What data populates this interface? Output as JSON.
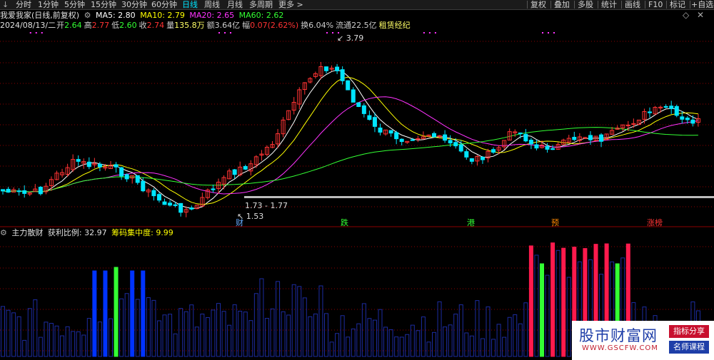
{
  "topbar": {
    "back_glyph": "↓",
    "tabs": [
      {
        "label": "分时",
        "active": false
      },
      {
        "label": "1分钟",
        "active": false
      },
      {
        "label": "5分钟",
        "active": false
      },
      {
        "label": "15分钟",
        "active": false
      },
      {
        "label": "30分钟",
        "active": false
      },
      {
        "label": "60分钟",
        "active": false
      },
      {
        "label": "日线",
        "active": true
      },
      {
        "label": "周线",
        "active": false
      },
      {
        "label": "月线",
        "active": false
      },
      {
        "label": "多周期",
        "active": false
      },
      {
        "label": "更多 >",
        "active": false
      }
    ],
    "right_buttons": [
      "复权",
      "叠加",
      "多股",
      "统计",
      "画线",
      "F10",
      "标记",
      "+自选"
    ]
  },
  "header": {
    "stock_name": "我爱我家(日线,前复权)",
    "ma": [
      {
        "label": "MA5: 2.80",
        "color": "#ffffff"
      },
      {
        "label": "MA10: 2.79",
        "color": "#ffff00"
      },
      {
        "label": "MA20: 2.65",
        "color": "#ff33ff"
      },
      {
        "label": "MA60: 2.62",
        "color": "#33ff33"
      }
    ],
    "window_icons": [
      "◇",
      "✕"
    ]
  },
  "quote": {
    "date": "2024/08/13/二",
    "open_label": "开",
    "open": "2.64",
    "high_label": "高",
    "high": "2.77",
    "low_label": "低",
    "low": "2.60",
    "close_label": "收",
    "close": "2.74",
    "vol_label": "量",
    "vol": "135.8万",
    "amount_label": "额",
    "amount": "3.64亿",
    "change_label": "幅",
    "change": "0.07(2.62%)",
    "turnover_label": "换",
    "turnover": "6.04%",
    "float_label": "流通",
    "float": "22.5亿",
    "concept": "租赁经纪"
  },
  "annotations": {
    "high_label": "3.79",
    "low_label": "1.53",
    "range_label": "1.73 - 1.77",
    "events": [
      {
        "label": "财",
        "color": "#66aaff"
      },
      {
        "label": "跌",
        "color": "#33ff33"
      },
      {
        "label": "港",
        "color": "#33ff33"
      },
      {
        "label": "预",
        "color": "#ff8800"
      },
      {
        "label": "涨榜",
        "color": "#ff3333"
      }
    ]
  },
  "indicator": {
    "name": "主力散财",
    "ratio_label": "获利比例:",
    "ratio_value": "32.97",
    "conc_label": "筹码集中度:",
    "conc_value": "9.99"
  },
  "watermark": {
    "main": "股市财富网",
    "url": "WWW.GSCFW.COM",
    "tag1": "指标分享",
    "tag2": "名师课程"
  },
  "colors": {
    "up": "#ff3333",
    "down": "#00e5ff",
    "ma5": "#ffffff",
    "ma10": "#ffff00",
    "ma20": "#ff33ff",
    "ma60": "#33ff33",
    "grid": "#8b0000"
  }
}
